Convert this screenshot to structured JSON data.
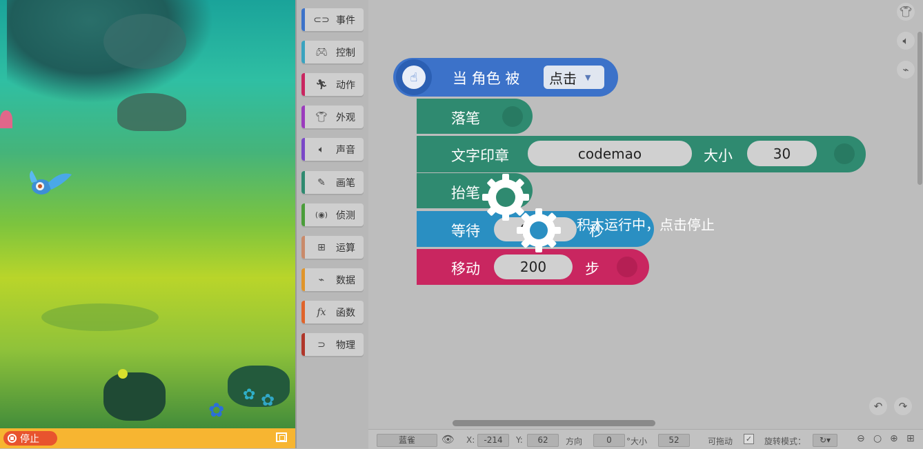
{
  "stage": {
    "stop_label": "停止",
    "colors": {
      "stop_bg": "#e8542e",
      "bar_bg": "#f7b531"
    }
  },
  "palette": [
    {
      "label": "事件",
      "icon": "toggle-icon",
      "glyph": "⊂⊃",
      "color": "#3c72c9"
    },
    {
      "label": "控制",
      "icon": "gamepad-icon",
      "glyph": "🎮︎",
      "color": "#3aa3bf"
    },
    {
      "label": "动作",
      "icon": "running-icon",
      "glyph": "🏃︎",
      "color": "#c92660"
    },
    {
      "label": "外观",
      "icon": "shirt-icon",
      "glyph": "👕︎",
      "color": "#9b3bbd"
    },
    {
      "label": "声音",
      "icon": "speaker-icon",
      "glyph": "🔈︎",
      "color": "#7a48c7"
    },
    {
      "label": "画笔",
      "icon": "pencil-icon",
      "glyph": "✎",
      "color": "#2f8a70"
    },
    {
      "label": "侦测",
      "icon": "sensor-icon",
      "glyph": "(◉)",
      "color": "#4a9d3a"
    },
    {
      "label": "运算",
      "icon": "calculator-icon",
      "glyph": "⊞",
      "color": "#c98a6a"
    },
    {
      "label": "数据",
      "icon": "line-chart-icon",
      "glyph": "⌁",
      "color": "#e0952b"
    },
    {
      "label": "函数",
      "icon": "function-icon",
      "glyph": "fx",
      "color": "#e0642b"
    },
    {
      "label": "物理",
      "icon": "magnet-icon",
      "glyph": "⊃",
      "color": "#b0362a"
    }
  ],
  "blocks": {
    "event": {
      "text": "当 角色 被",
      "dropdown": "点击"
    },
    "pen_down": "落笔",
    "stamp": {
      "text": "文字印章",
      "value": "codemao",
      "size_label": "大小",
      "size_value": "30"
    },
    "pen_up": "抬笔",
    "wait": {
      "text": "等待",
      "value": "0.02",
      "unit": "秒"
    },
    "move": {
      "text": "移动",
      "value": "200",
      "unit": "步"
    }
  },
  "overlay": {
    "message": "积木运行中，点击停止"
  },
  "status": {
    "sprite_name": "蓝雀",
    "x_label": "X:",
    "x_value": "-214",
    "y_label": "Y:",
    "y_value": "62",
    "dir_label": "方向",
    "dir_value": "0",
    "size_label": "°大小",
    "size_value": "52",
    "draggable_label": "可拖动",
    "rotate_label": "旋转模式："
  }
}
